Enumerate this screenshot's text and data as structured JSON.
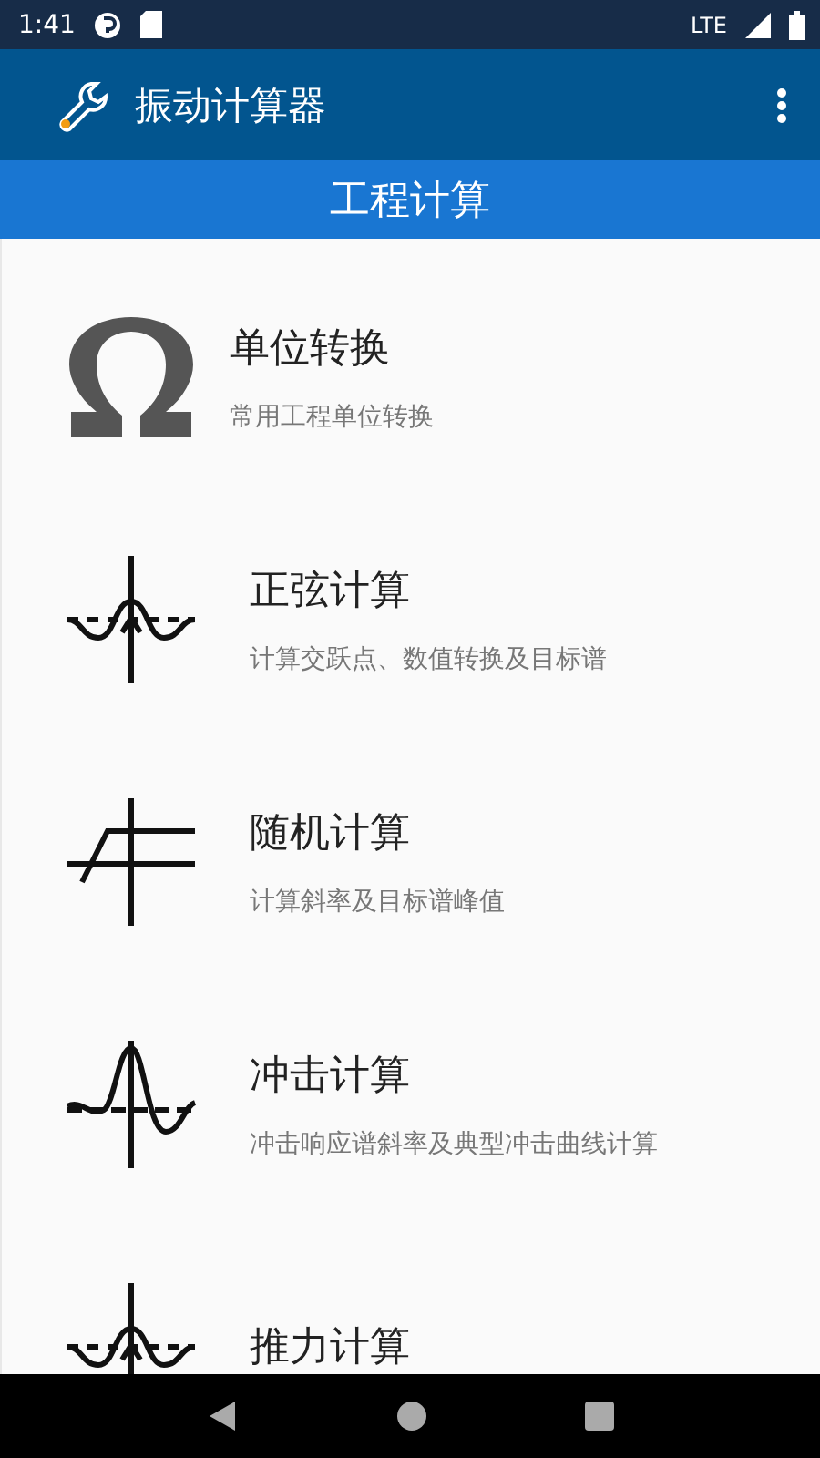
{
  "status_bar": {
    "time": "1:41",
    "network": "LTE"
  },
  "app_bar": {
    "title": "振动计算器"
  },
  "section_header": {
    "title": "工程计算"
  },
  "items": [
    {
      "kind": "omega",
      "title": "单位转换",
      "subtitle": "常用工程单位转换"
    },
    {
      "kind": "sine",
      "title": "正弦计算",
      "subtitle": "计算交跃点、数值转换及目标谱"
    },
    {
      "kind": "random",
      "title": "随机计算",
      "subtitle": "计算斜率及目标谱峰值"
    },
    {
      "kind": "shock",
      "title": "冲击计算",
      "subtitle": "冲击响应谱斜率及典型冲击曲线计算"
    },
    {
      "kind": "sine",
      "title": "推力计算"
    }
  ]
}
